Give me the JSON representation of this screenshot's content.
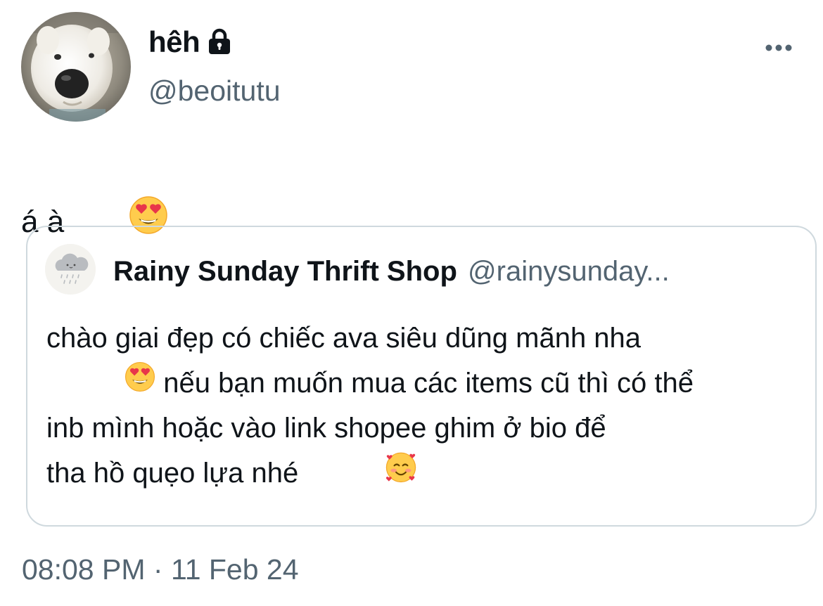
{
  "author": {
    "display_name": "hêh",
    "handle": "@beoitutu",
    "avatar_icon": "dog-avatar",
    "protected_icon": "lock-icon"
  },
  "tweet": {
    "text": "á à",
    "emoji": "heart-eyes-emoji"
  },
  "more_icon": "more-horizontal-icon",
  "quote": {
    "display_name": "Rainy Sunday Thrift Shop",
    "handle": "@rainysunday...",
    "avatar_icon": "rain-cloud-avatar",
    "lines": [
      {
        "text": "chào giai đẹp có chiếc ava siêu dũng mãnh nha"
      },
      {
        "emoji": "heart-eyes-emoji",
        "text": " nếu bạn muốn mua các items cũ thì có thể"
      },
      {
        "text": "inb mình hoặc vào link shopee ghim ở bio để"
      },
      {
        "text": "tha hồ quẹo lựa nhé ",
        "emoji_after": "smiling-face-with-hearts-emoji"
      }
    ]
  },
  "meta": {
    "time": "08:08 PM",
    "separator": " · ",
    "date": "11 Feb 24"
  },
  "colors": {
    "text": "#0f1419",
    "secondary": "#536471",
    "border": "#cfd9de"
  }
}
